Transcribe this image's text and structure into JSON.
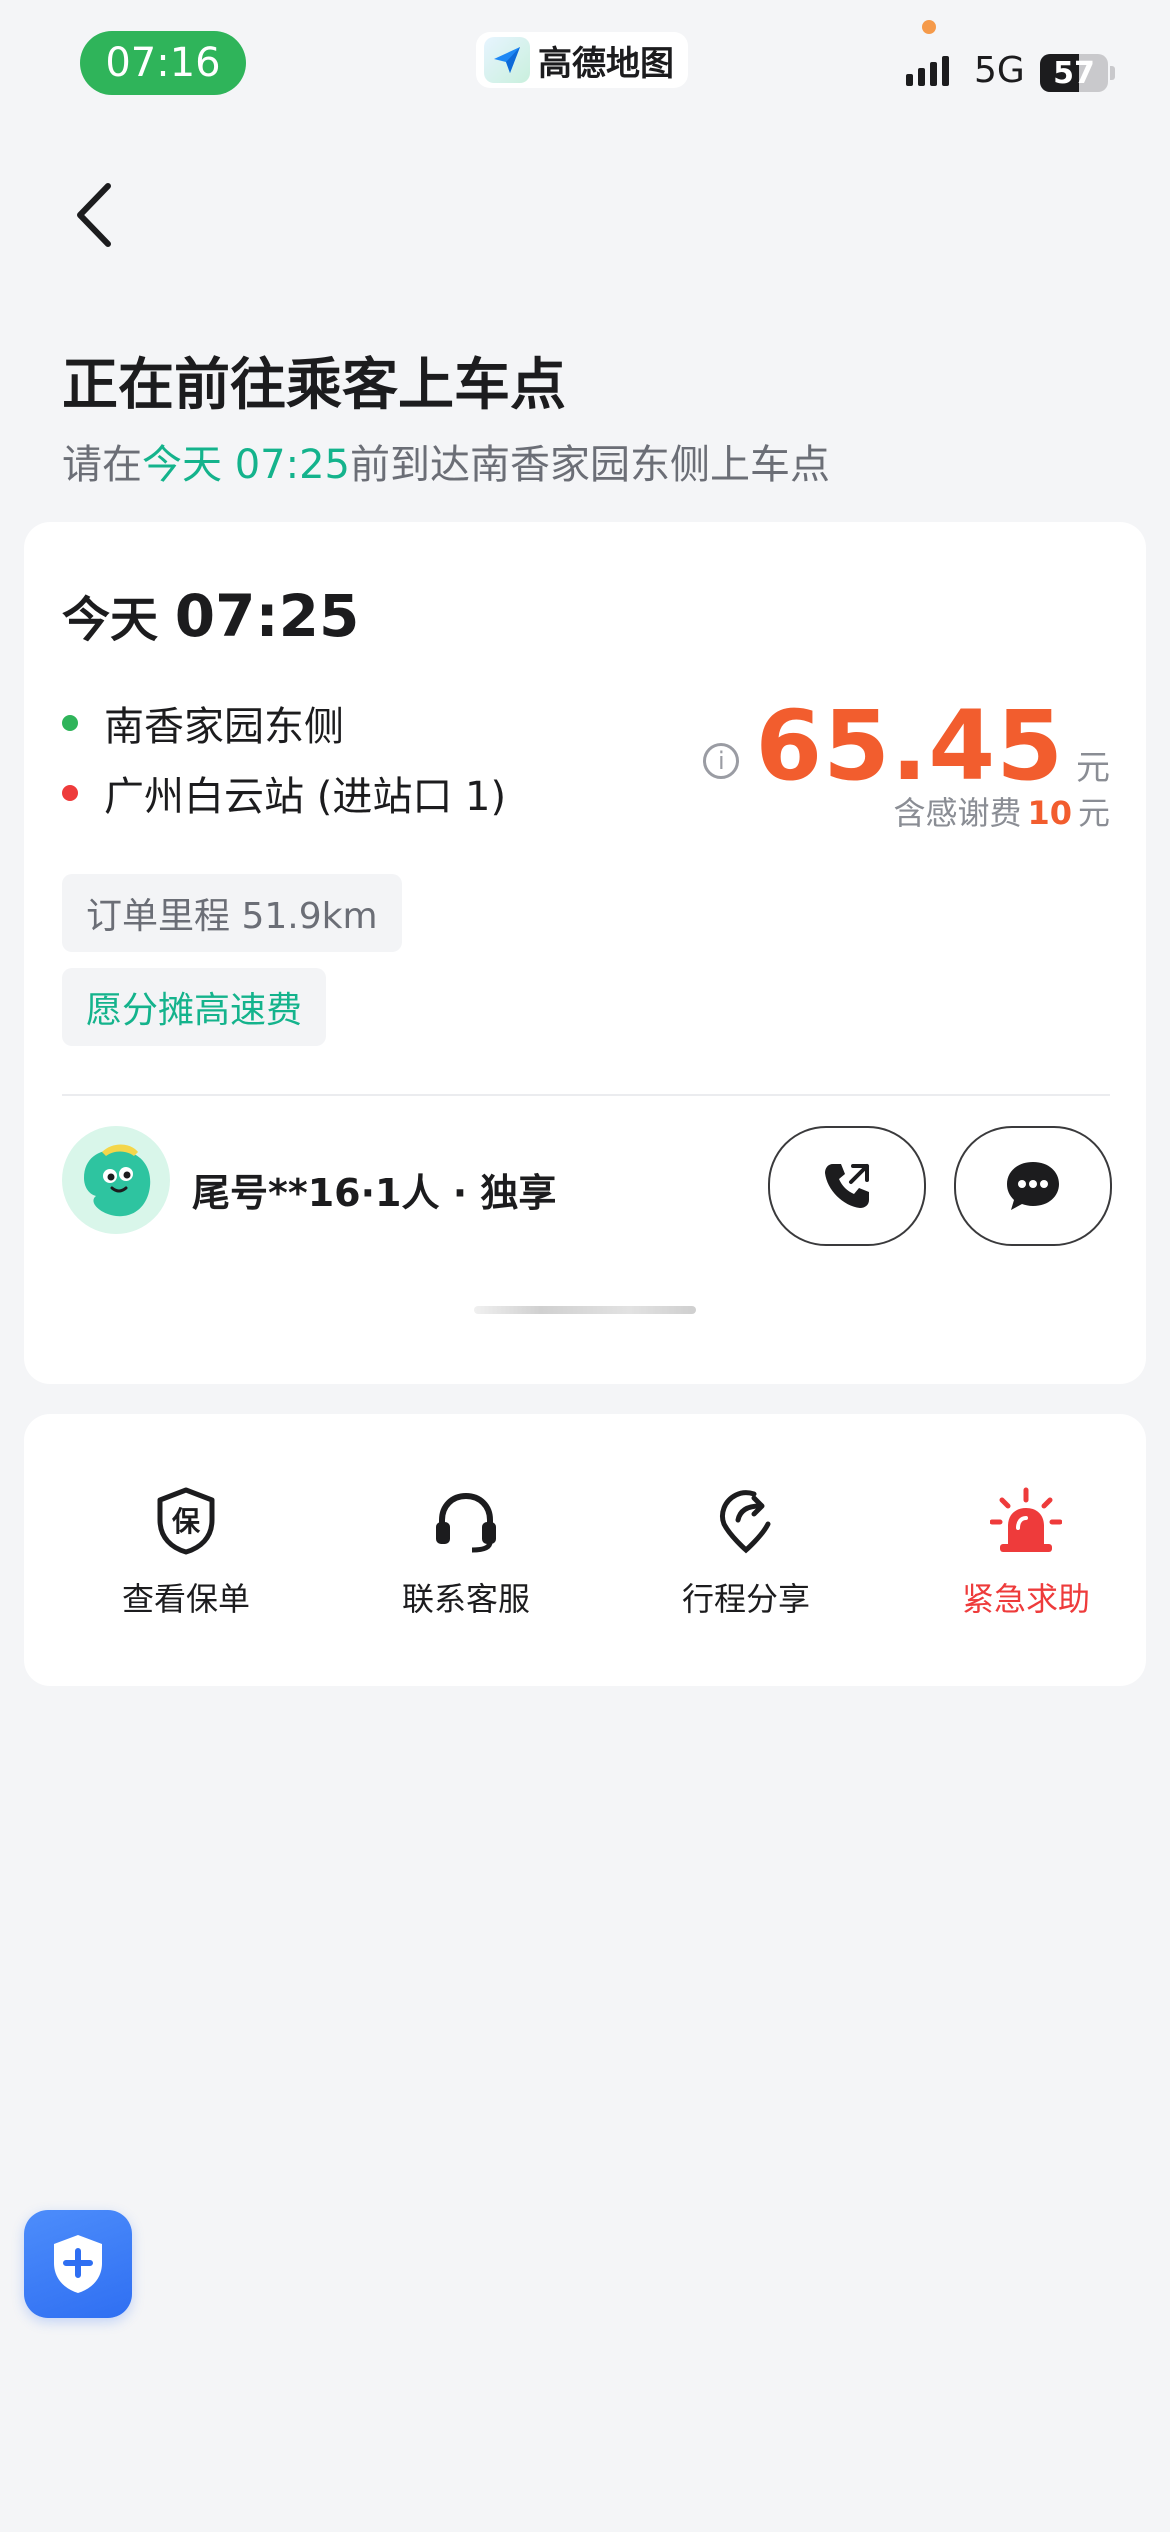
{
  "status_bar": {
    "time": "07:16",
    "app_name": "高德地图",
    "network": "5G",
    "battery": "57",
    "battery_level": 0.57
  },
  "header": {
    "title": "正在前往乘客上车点",
    "subtitle_prefix": "请在",
    "subtitle_highlight": "今天 07:25",
    "subtitle_suffix": "前到达南香家园东侧上车点"
  },
  "order": {
    "day": "今天",
    "time": "07:25",
    "start": "南香家园东侧",
    "end": "广州白云站 (进站口 1)",
    "price": "65.45",
    "price_unit": "元",
    "thanks_prefix": "含感谢费",
    "thanks_amount": "10",
    "thanks_unit": "元",
    "mileage_tag": "订单里程 51.9km",
    "toll_tag": "愿分摊高速费",
    "passenger": "尾号**16·1人 · 独享"
  },
  "actions": {
    "policy": "查看保单",
    "support": "联系客服",
    "share": "行程分享",
    "sos": "紧急求助"
  },
  "colors": {
    "accent": "#14b38c",
    "price": "#f25d2e",
    "danger": "#ee3b3b",
    "time_pill": "#2fb45a",
    "start_dot": "#2fb45a",
    "end_dot": "#ee3b3b"
  }
}
